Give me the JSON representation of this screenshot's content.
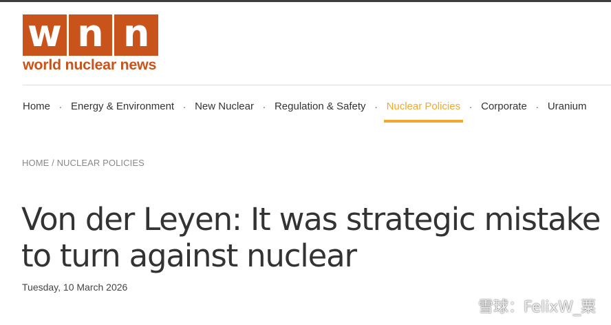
{
  "logo": {
    "letters": [
      "w",
      "n",
      "n"
    ],
    "text": "world nuclear news",
    "color": "#c9541b"
  },
  "nav": {
    "items": [
      {
        "label": "Home",
        "active": false
      },
      {
        "label": "Energy & Environment",
        "active": false
      },
      {
        "label": "New Nuclear",
        "active": false
      },
      {
        "label": "Regulation & Safety",
        "active": false
      },
      {
        "label": "Nuclear Policies",
        "active": true
      },
      {
        "label": "Corporate",
        "active": false
      },
      {
        "label": "Uranium",
        "active": false
      }
    ],
    "separator": "·",
    "active_color": "#f0a92e"
  },
  "breadcrumb": {
    "home": "HOME",
    "separator": "/",
    "current": "NUCLEAR POLICIES"
  },
  "article": {
    "title": "Von der Leyen: It was strategic mistake to turn against nuclear",
    "date": "Tuesday, 10 March 2026"
  },
  "watermark": {
    "text": "雪球：FelixW_粟",
    "icon": "snowball-logo-icon"
  }
}
